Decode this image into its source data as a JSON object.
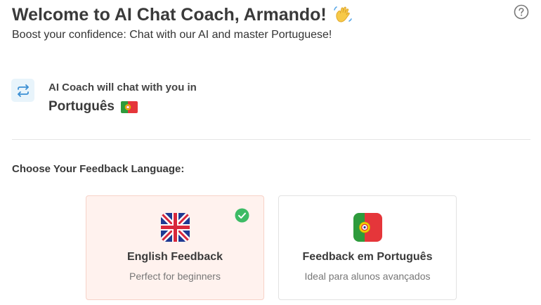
{
  "header": {
    "title": "Welcome to AI Chat Coach, Armando!",
    "wave_icon": "waving-hand-icon",
    "subtitle": "Boost your confidence: Chat with our AI and master Portuguese!",
    "help_icon": "question-circle-icon"
  },
  "coach": {
    "icon": "swap-arrows-icon",
    "line1": "AI Coach will chat with you in",
    "language": "Português",
    "flag_icon": "portugal-flag-icon"
  },
  "feedback": {
    "label": "Choose Your Feedback Language:",
    "options": [
      {
        "title": "English Feedback",
        "description": "Perfect for beginners",
        "flag_icon": "uk-flag-icon",
        "selected": true
      },
      {
        "title": "Feedback em Português",
        "description": "Ideal para alunos avançados",
        "flag_icon": "portugal-flag-icon",
        "selected": false
      }
    ]
  },
  "colors": {
    "selected_card_bg": "#fff2ee",
    "check_green": "#3dbb65",
    "icon_blue": "#3b8fd4",
    "portugal_green": "#2e9b3c",
    "portugal_red": "#e5363a"
  }
}
